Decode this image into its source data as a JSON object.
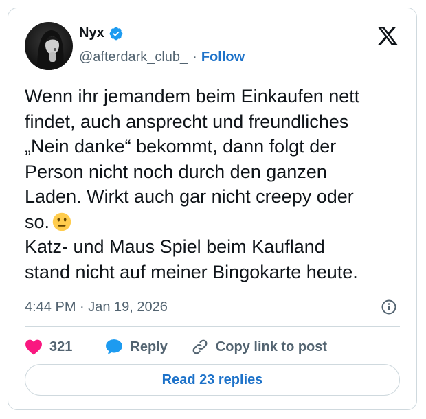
{
  "author": {
    "name": "Nyx",
    "handle": "@afterdark_club_",
    "separator": "·",
    "follow_label": "Follow"
  },
  "tweet": {
    "text_main": "Wenn ihr jemandem beim Einkaufen nett\nfindet, auch ansprecht und freundliches\n„Nein danke“ bekommt, dann folgt der\nPerson nicht noch durch den ganzen\nLaden. Wirkt auch gar nicht creepy oder\nso.",
    "text_after_emoji": "\nKatz- und Maus Spiel beim Kaufland\nstand nicht auf meiner Bingokarte heute.",
    "emoji": "neutral-face",
    "timestamp": "4:44 PM · Jan 19, 2026"
  },
  "actions": {
    "like_count": "321",
    "reply_label": "Reply",
    "copy_link_label": "Copy link to post"
  },
  "replies_button_label": "Read 23 replies",
  "colors": {
    "accent": "#1d72c9",
    "verified": "#1d9bf0",
    "like": "#f91880",
    "secondary_text": "#536471",
    "border": "#cfd9de"
  }
}
